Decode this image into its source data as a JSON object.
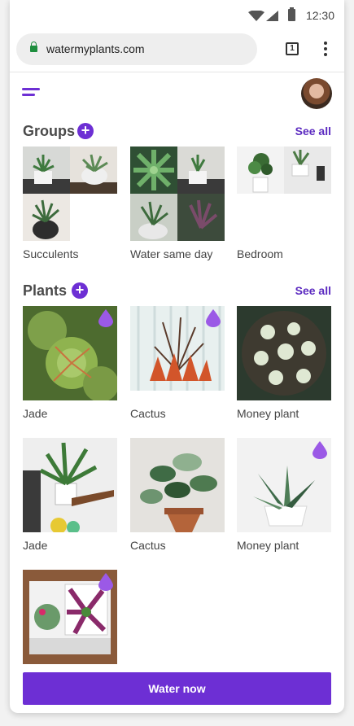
{
  "status_bar": {
    "time": "12:30"
  },
  "browser": {
    "url": "watermyplants.com",
    "tab_count": "1"
  },
  "groups": {
    "title": "Groups",
    "see_all": "See all",
    "items": [
      {
        "label": "Succulents"
      },
      {
        "label": "Water same day"
      },
      {
        "label": "Bedroom"
      }
    ]
  },
  "plants": {
    "title": "Plants",
    "see_all": "See all",
    "items": [
      {
        "label": "Jade",
        "needs_water": true
      },
      {
        "label": "Cactus",
        "needs_water": true
      },
      {
        "label": "Money plant",
        "needs_water": false
      },
      {
        "label": "Jade",
        "needs_water": false
      },
      {
        "label": "Cactus",
        "needs_water": false
      },
      {
        "label": "Money plant",
        "needs_water": true
      },
      {
        "label": "",
        "needs_water": true
      }
    ]
  },
  "action": {
    "water_now": "Water now"
  },
  "colors": {
    "accent": "#6d2fd4",
    "drop": "#9b59e6",
    "lock": "#1e8e3e"
  }
}
